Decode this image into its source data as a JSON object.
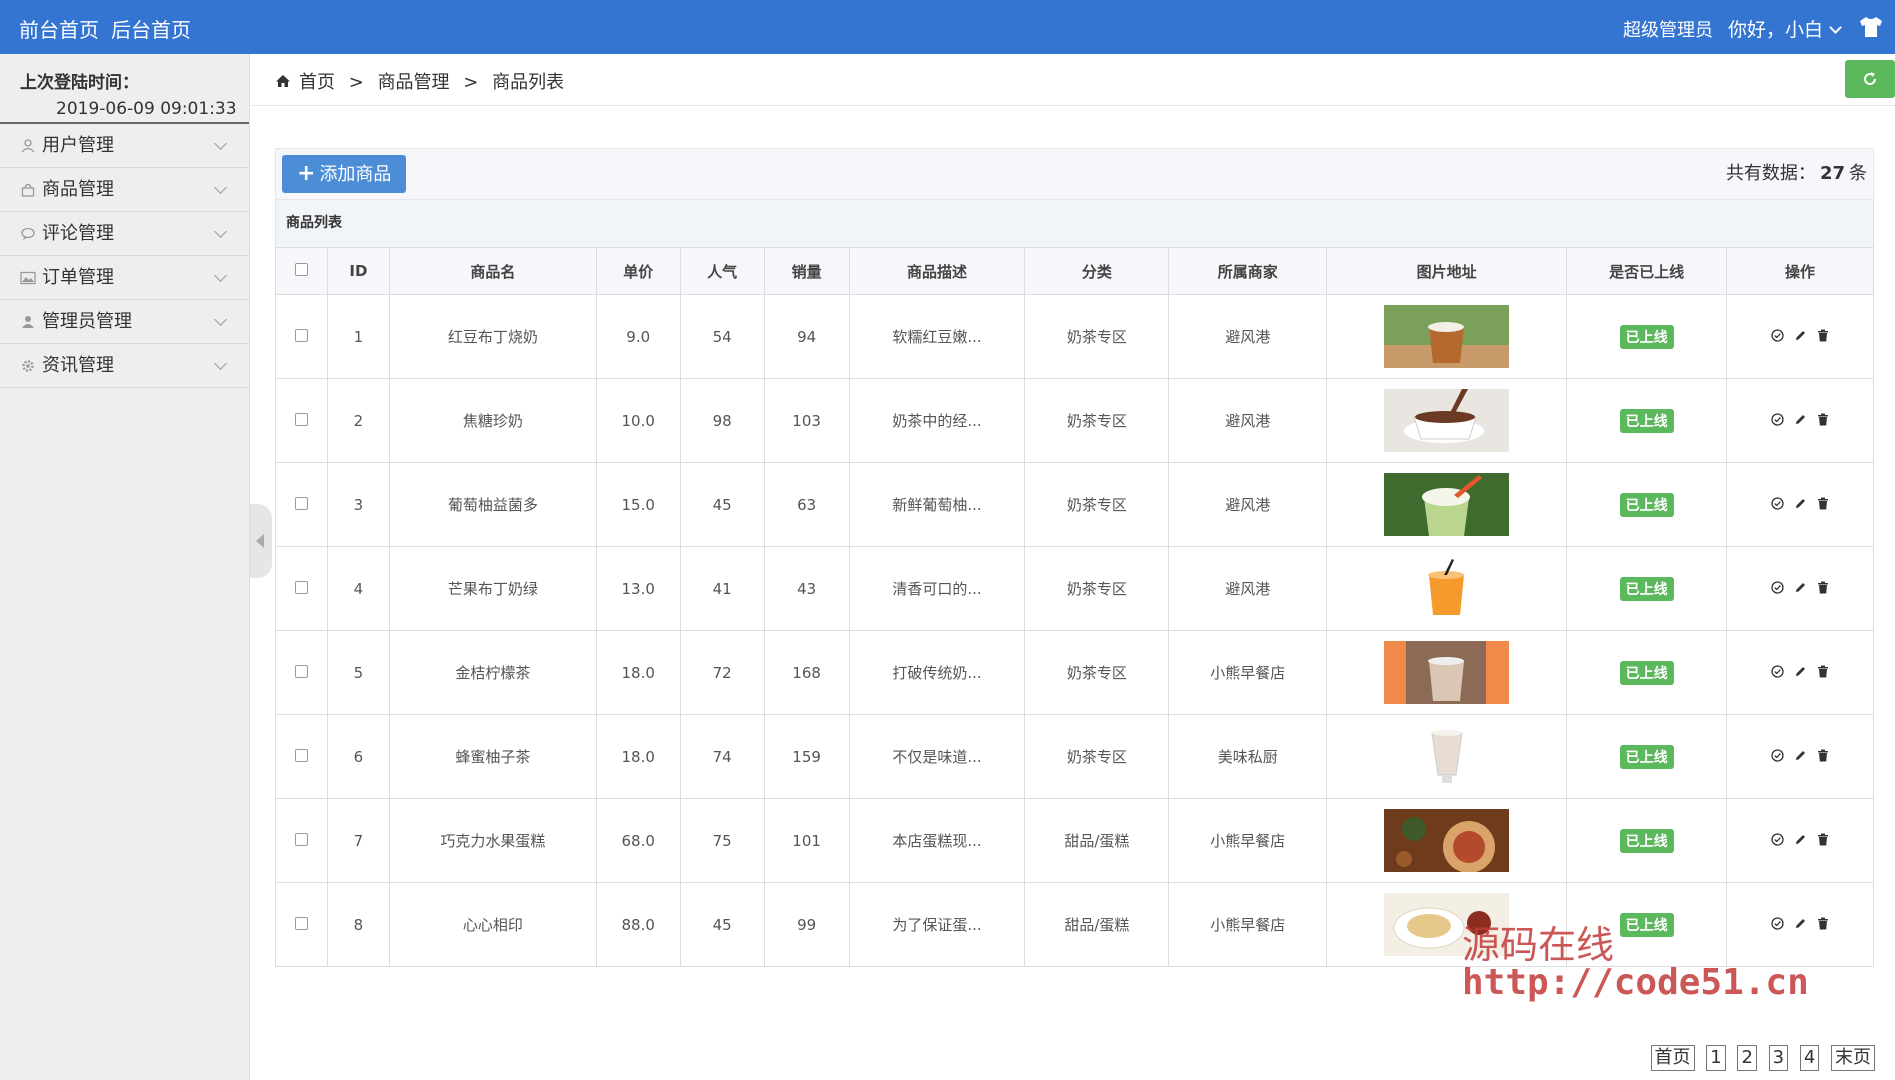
{
  "topbar": {
    "front_home": "前台首页",
    "back_home": "后台首页",
    "role": "超级管理员",
    "greeting": "你好，小白",
    "bg_color": "#3475d1"
  },
  "sidebar": {
    "last_login_label": "上次登陆时间：",
    "last_login_time": "2019-06-09 09:01:33",
    "menu": [
      {
        "label": "用户管理",
        "icon": "user-icon"
      },
      {
        "label": "商品管理",
        "icon": "bag-icon"
      },
      {
        "label": "评论管理",
        "icon": "comment-icon"
      },
      {
        "label": "订单管理",
        "icon": "image-icon"
      },
      {
        "label": "管理员管理",
        "icon": "admin-icon"
      },
      {
        "label": "资讯管理",
        "icon": "gear-icon"
      }
    ]
  },
  "breadcrumb": {
    "home": "首页",
    "sep": ">",
    "level1": "商品管理",
    "level2": "商品列表"
  },
  "toolbar": {
    "add_label": "添加商品",
    "total_label": "共有数据：",
    "total_count": "27",
    "total_unit": "条"
  },
  "list_title": "商品列表",
  "table": {
    "headers": [
      "ID",
      "商品名",
      "单价",
      "人气",
      "销量",
      "商品描述",
      "分类",
      "所属商家",
      "图片地址",
      "是否已上线",
      "操作"
    ],
    "rows": [
      {
        "id": "1",
        "name": "红豆布丁烧奶",
        "price": "9.0",
        "popularity": "54",
        "sales": "94",
        "desc": "软糯红豆嫩...",
        "category": "奶茶专区",
        "shop": "避风港",
        "status": "已上线"
      },
      {
        "id": "2",
        "name": "焦糖珍奶",
        "price": "10.0",
        "popularity": "98",
        "sales": "103",
        "desc": "奶茶中的经...",
        "category": "奶茶专区",
        "shop": "避风港",
        "status": "已上线"
      },
      {
        "id": "3",
        "name": "葡萄柚益菌多",
        "price": "15.0",
        "popularity": "45",
        "sales": "63",
        "desc": "新鲜葡萄柚...",
        "category": "奶茶专区",
        "shop": "避风港",
        "status": "已上线"
      },
      {
        "id": "4",
        "name": "芒果布丁奶绿",
        "price": "13.0",
        "popularity": "41",
        "sales": "43",
        "desc": "清香可口的...",
        "category": "奶茶专区",
        "shop": "避风港",
        "status": "已上线"
      },
      {
        "id": "5",
        "name": "金桔柠檬茶",
        "price": "18.0",
        "popularity": "72",
        "sales": "168",
        "desc": "打破传统奶...",
        "category": "奶茶专区",
        "shop": "小熊早餐店",
        "status": "已上线"
      },
      {
        "id": "6",
        "name": "蜂蜜柚子茶",
        "price": "18.0",
        "popularity": "74",
        "sales": "159",
        "desc": "不仅是味道...",
        "category": "奶茶专区",
        "shop": "美味私厨",
        "status": "已上线"
      },
      {
        "id": "7",
        "name": "巧克力水果蛋糕",
        "price": "68.0",
        "popularity": "75",
        "sales": "101",
        "desc": "本店蛋糕现...",
        "category": "甜品/蛋糕",
        "shop": "小熊早餐店",
        "status": "已上线"
      },
      {
        "id": "8",
        "name": "心心相印",
        "price": "88.0",
        "popularity": "45",
        "sales": "99",
        "desc": "为了保证蛋...",
        "category": "甜品/蛋糕",
        "shop": "小熊早餐店",
        "status": "已上线"
      }
    ]
  },
  "watermark": {
    "line1": "源码在线",
    "line2": "http://code51.cn"
  },
  "pager": {
    "first": "首页",
    "pages": [
      "1",
      "2",
      "3",
      "4"
    ],
    "last": "末页"
  }
}
